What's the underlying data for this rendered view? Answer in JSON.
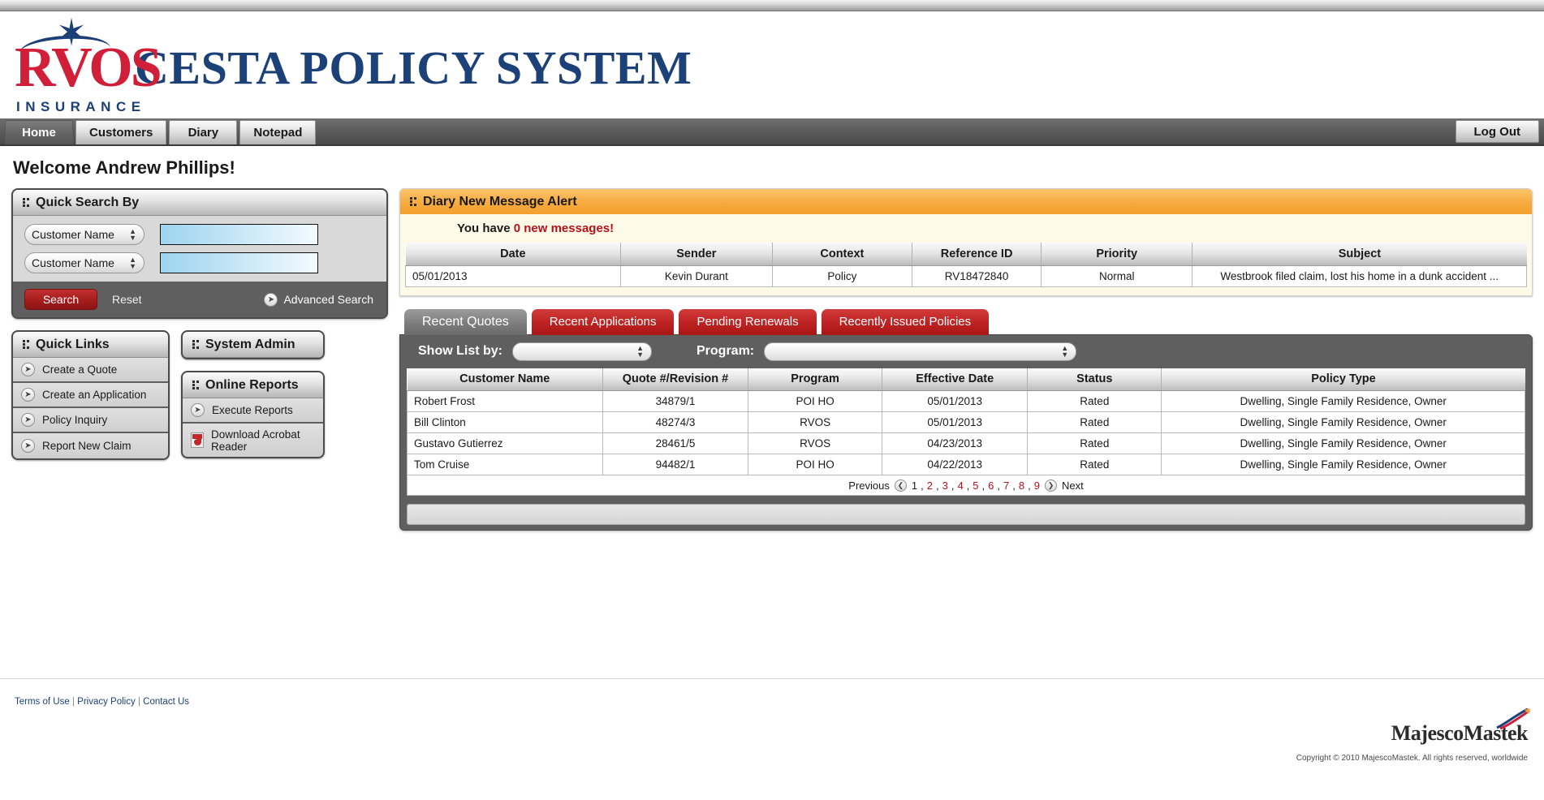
{
  "header": {
    "logo_text": "RVOS",
    "logo_subtext": "INSURANCE",
    "title": "CESTA POLICY SYSTEM"
  },
  "nav": {
    "tabs": [
      {
        "label": "Home",
        "active": true
      },
      {
        "label": "Customers",
        "active": false
      },
      {
        "label": "Diary",
        "active": false
      },
      {
        "label": "Notepad",
        "active": false
      }
    ],
    "logout_label": "Log Out"
  },
  "welcome": "Welcome Andrew Phillips!",
  "quick_search": {
    "title": "Quick Search By",
    "row1_select": "Customer Name",
    "row1_value": "",
    "row2_select": "Customer Name",
    "row2_value": "",
    "search_label": "Search",
    "reset_label": "Reset",
    "advanced_label": "Advanced Search"
  },
  "quick_links": {
    "title": "Quick Links",
    "items": [
      {
        "label": "Create a Quote"
      },
      {
        "label": "Create an Application"
      },
      {
        "label": "Policy Inquiry"
      },
      {
        "label": "Report New Claim"
      }
    ]
  },
  "system_admin": {
    "title": "System Admin"
  },
  "online_reports": {
    "title": "Online Reports",
    "items": [
      {
        "label": "Execute Reports",
        "icon": "arrow-circle-icon"
      },
      {
        "label": "Download Acrobat Reader",
        "icon": "pdf-icon"
      }
    ]
  },
  "diary": {
    "title": "Diary New Message Alert",
    "message_prefix": "You have ",
    "message_count": "0 new messages!",
    "columns": [
      "Date",
      "Sender",
      "Context",
      "Reference ID",
      "Priority",
      "Subject"
    ],
    "rows": [
      {
        "date": "05/01/2013",
        "sender": "Kevin Durant",
        "context": "Policy",
        "reference_id": "RV18472840",
        "priority": "Normal",
        "subject": "Westbrook filed claim, lost his home in a dunk accident ..."
      }
    ]
  },
  "quotes": {
    "tabs": [
      {
        "label": "Recent Quotes",
        "active": true
      },
      {
        "label": "Recent Applications",
        "active": false
      },
      {
        "label": "Pending Renewals",
        "active": false
      },
      {
        "label": "Recently Issued Policies",
        "active": false
      }
    ],
    "show_list_label": "Show List by:",
    "show_list_value": "",
    "program_label": "Program:",
    "program_value": "",
    "columns": [
      "Customer Name",
      "Quote #/Revision #",
      "Program",
      "Effective Date",
      "Status",
      "Policy Type"
    ],
    "rows": [
      {
        "customer_name": "Robert Frost",
        "quote_revision": "34879/1",
        "program": "POI HO",
        "effective_date": "05/01/2013",
        "status": "Rated",
        "policy_type": "Dwelling, Single Family Residence, Owner"
      },
      {
        "customer_name": "Bill Clinton",
        "quote_revision": "48274/3",
        "program": "RVOS",
        "effective_date": "05/01/2013",
        "status": "Rated",
        "policy_type": "Dwelling, Single Family Residence, Owner"
      },
      {
        "customer_name": "Gustavo Gutierrez",
        "quote_revision": "28461/5",
        "program": "RVOS",
        "effective_date": "04/23/2013",
        "status": "Rated",
        "policy_type": "Dwelling, Single Family Residence, Owner"
      },
      {
        "customer_name": "Tom Cruise",
        "quote_revision": "94482/1",
        "program": "POI HO",
        "effective_date": "04/22/2013",
        "status": "Rated",
        "policy_type": "Dwelling, Single Family Residence, Owner"
      }
    ],
    "pagination": {
      "previous_label": "Previous",
      "next_label": "Next",
      "pages": [
        "1",
        "2",
        "3",
        "4",
        "5",
        "6",
        "7",
        "8",
        "9"
      ],
      "current": "1"
    }
  },
  "footer": {
    "links": [
      "Terms of Use",
      "Privacy Policy",
      "Contact Us"
    ],
    "separator": "|",
    "brand_a": "Majesco",
    "brand_b": "Mastek",
    "copyright": "Copyright © 2010 MajescoMastek. All rights reserved, worldwide"
  },
  "colors": {
    "brand_red": "#d11f3a",
    "brand_blue": "#1c4178",
    "accent_red": "#b3121c",
    "alert_orange": "#f3a030"
  }
}
